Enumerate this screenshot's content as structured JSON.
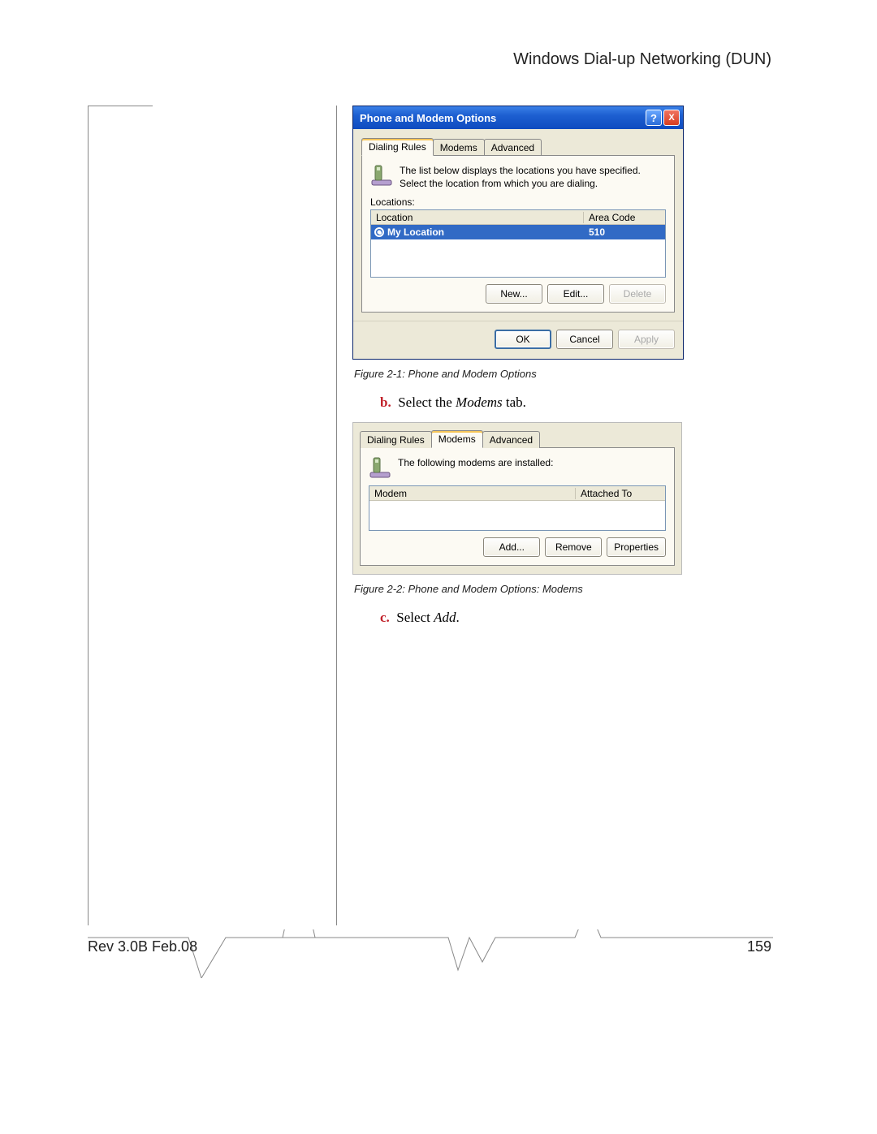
{
  "page": {
    "header_title": "Windows Dial-up Networking (DUN)",
    "rev": "Rev 3.0B Feb.08",
    "page_number": "159"
  },
  "dialog1": {
    "title": "Phone and Modem Options",
    "tabs": {
      "t1": "Dialing Rules",
      "t2": "Modems",
      "t3": "Advanced"
    },
    "info_text": "The list below displays the locations you have specified. Select the location from which you are dialing.",
    "locations_label": "Locations:",
    "headers": {
      "location": "Location",
      "areacode": "Area Code"
    },
    "row": {
      "name": "My Location",
      "areacode": "510"
    },
    "buttons": {
      "new": "New...",
      "edit": "Edit...",
      "delete": "Delete",
      "ok": "OK",
      "cancel": "Cancel",
      "apply": "Apply"
    }
  },
  "captions": {
    "fig1": "Figure 2-1: Phone and Modem Options",
    "fig2": "Figure 2-2: Phone and Modem Options: Modems"
  },
  "steps": {
    "b_letter": "b.",
    "b_text_1": "Select the ",
    "b_text_2": "Modems",
    "b_text_3": " tab.",
    "c_letter": "c.",
    "c_text_1": "Select ",
    "c_text_2": "Add",
    "c_text_3": "."
  },
  "dialog2": {
    "tabs": {
      "t1": "Dialing Rules",
      "t2": "Modems",
      "t3": "Advanced"
    },
    "info_text": "The following modems are  installed:",
    "headers": {
      "modem": "Modem",
      "attached": "Attached To"
    },
    "buttons": {
      "add": "Add...",
      "remove": "Remove",
      "properties": "Properties"
    }
  }
}
